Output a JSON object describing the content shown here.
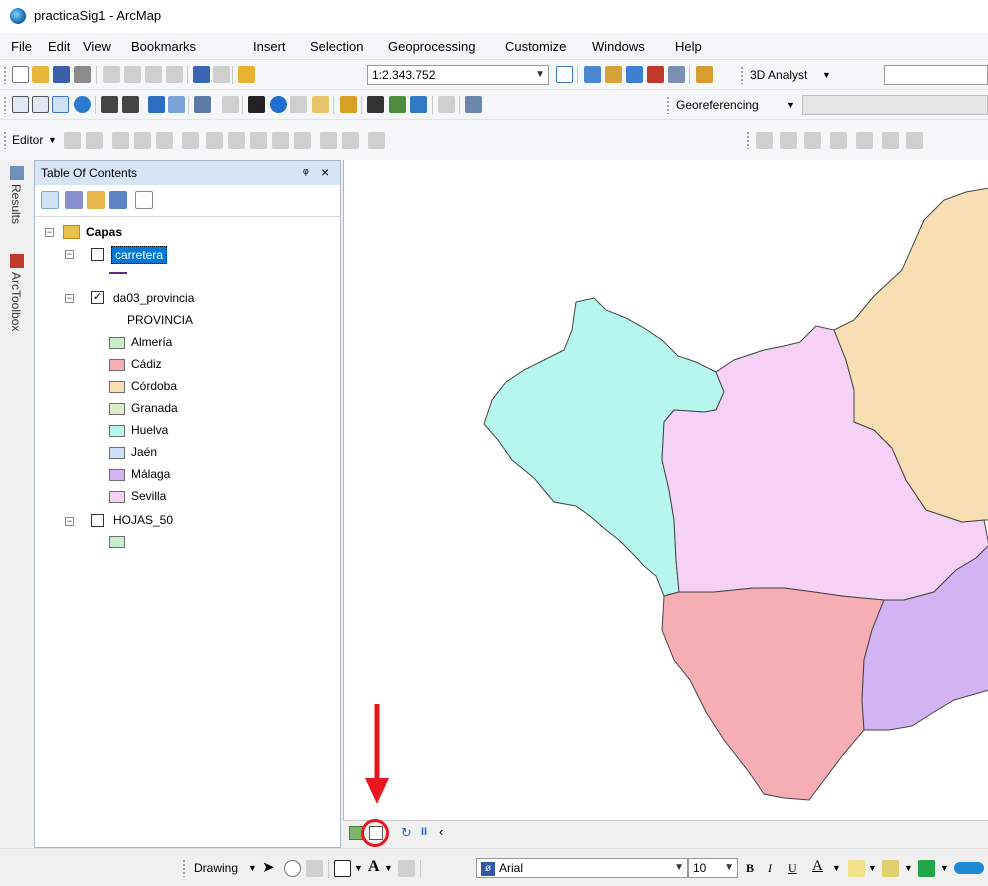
{
  "app": {
    "title": "practicaSig1 - ArcMap"
  },
  "menu": [
    "File",
    "Edit",
    "View",
    "Bookmarks",
    "Insert",
    "Selection",
    "Geoprocessing",
    "Customize",
    "Windows",
    "Help"
  ],
  "toolbar1": {
    "scale_value": "1:2.343.752",
    "analyst_label": "3D Analyst"
  },
  "toolbar2": {
    "georef_label": "Georeferencing"
  },
  "toolbar3": {
    "editor_label": "Editor"
  },
  "side_tabs": {
    "results": "Results",
    "toolbox": "ArcToolbox"
  },
  "toc": {
    "title": "Table Of Contents",
    "pin": "ᵠ",
    "close": "×",
    "frame": "Capas",
    "layers": [
      {
        "name": "carretera",
        "checked": false,
        "selected": true
      },
      {
        "name": "da03_provincia",
        "checked": true,
        "selected": false
      },
      {
        "name": "HOJAS_50",
        "checked": false,
        "selected": false
      }
    ],
    "field_name": "PROVINCIA",
    "legend": [
      {
        "label": "Almería",
        "color": "#c6eecb"
      },
      {
        "label": "Cádiz",
        "color": "#f5aeb4"
      },
      {
        "label": "Córdoba",
        "color": "#f7dfb3"
      },
      {
        "label": "Granada",
        "color": "#d9edc6"
      },
      {
        "label": "Huelva",
        "color": "#b7f6ef"
      },
      {
        "label": "Jaén",
        "color": "#cfe0f5"
      },
      {
        "label": "Málaga",
        "color": "#d2b3f3"
      },
      {
        "label": "Sevilla",
        "color": "#f5d2f5"
      }
    ],
    "hojas_color": "#c6eecb"
  },
  "map": {
    "colors": {
      "huelva": "#b7f6ef",
      "sevilla": "#f5d2f5",
      "cordoba": "#f7dfb3",
      "cadiz": "#f5aeb4",
      "malaga": "#d2b3f3"
    }
  },
  "drawing": {
    "label": "Drawing",
    "font": "Arial",
    "size": "10",
    "bold": "B",
    "italic": "I",
    "underline": "U",
    "text_a": "A"
  },
  "annotation": {
    "color": "#e8161e"
  }
}
